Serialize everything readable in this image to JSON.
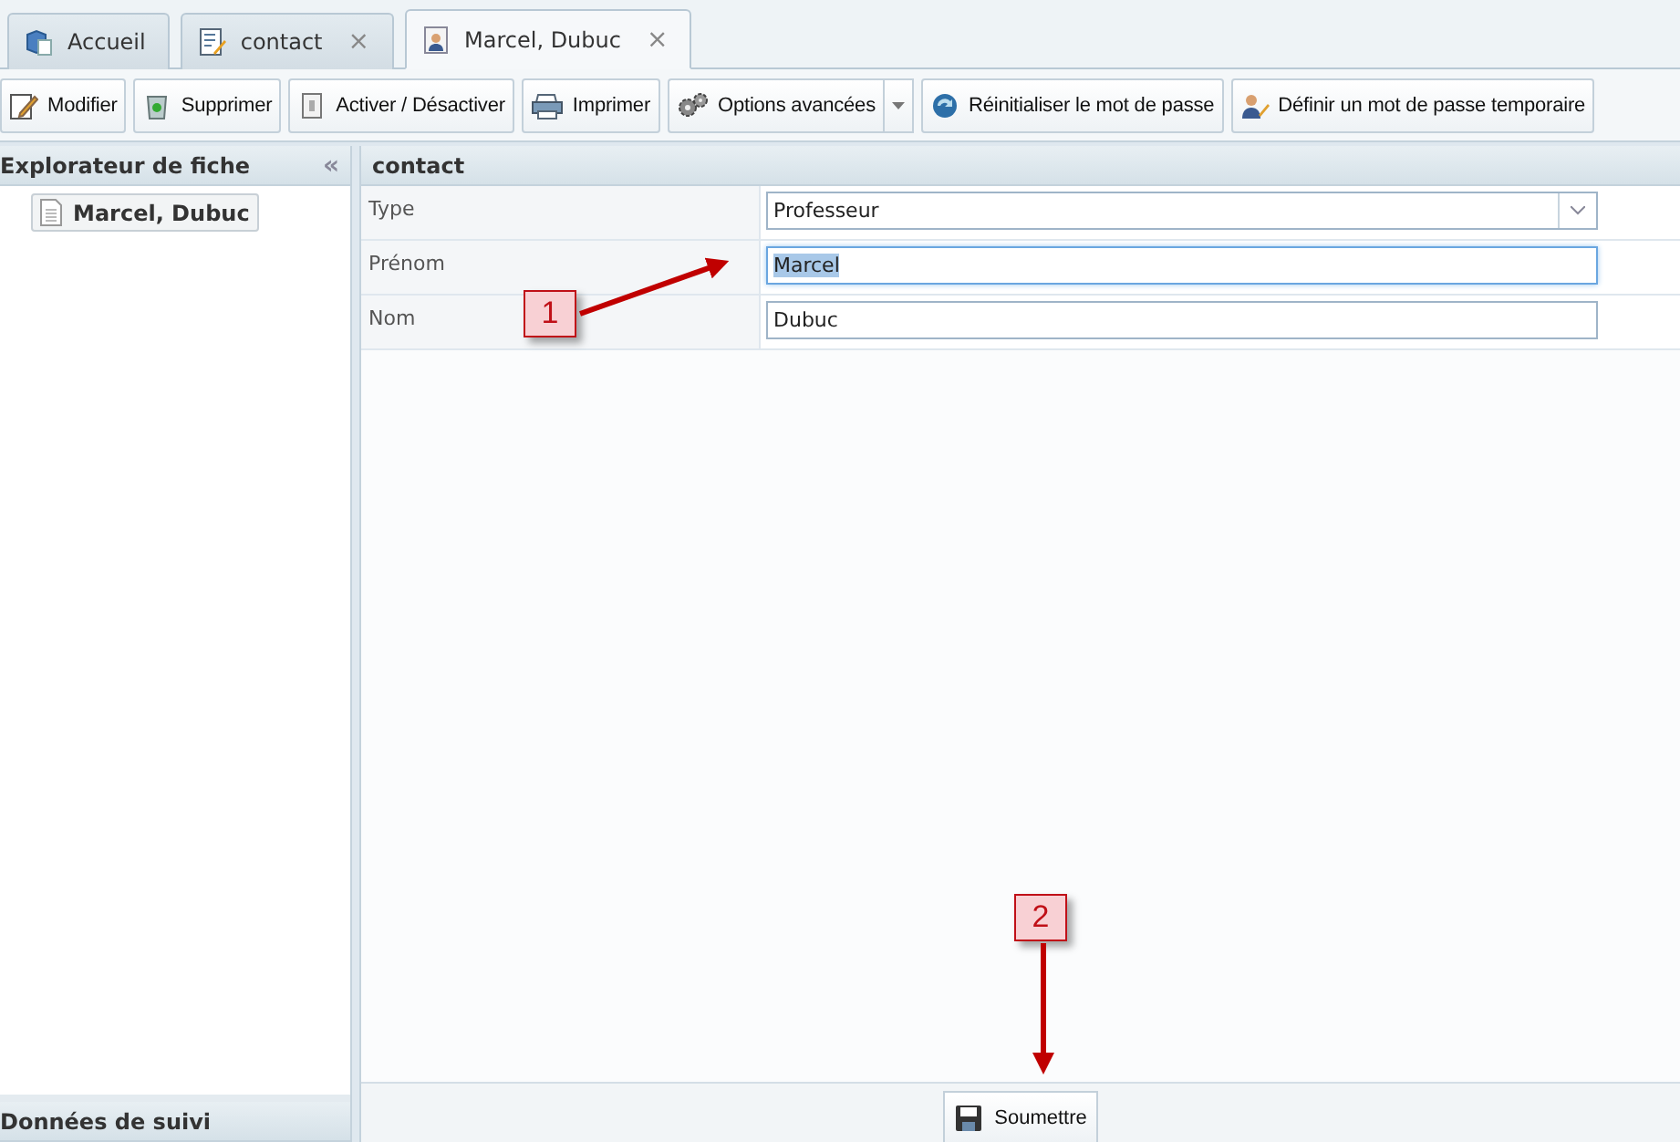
{
  "tabs": [
    {
      "label": "Accueil",
      "selected": false
    },
    {
      "label": "contact",
      "selected": false,
      "close": "×"
    },
    {
      "label": "Marcel, Dubuc",
      "selected": true,
      "close": "×"
    }
  ],
  "toolbar": [
    {
      "label": "Modifier",
      "kind": "button"
    },
    {
      "label": "Supprimer",
      "kind": "button"
    },
    {
      "label": "Activer / Désactiver",
      "kind": "button"
    },
    {
      "label": "Imprimer",
      "kind": "button"
    },
    {
      "label": "Options avancées",
      "kind": "split"
    },
    {
      "label": "Réinitialiser le mot de passe",
      "kind": "button"
    },
    {
      "label": "Définir un mot de passe temporaire",
      "kind": "button"
    }
  ],
  "explorer": {
    "title": "Explorateur de fiche",
    "collapse": "«",
    "items": [
      {
        "label": "Marcel, Dubuc"
      }
    ]
  },
  "tracking": {
    "title": "Données de suivi"
  },
  "form": {
    "title": "contact",
    "fields": [
      {
        "label": "Type",
        "kind": "select",
        "value": "Professeur",
        "focused": false
      },
      {
        "label": "Prénom",
        "kind": "text",
        "value": "Marcel",
        "focused": true
      },
      {
        "label": "Nom",
        "kind": "text",
        "value": "Dubuc",
        "focused": false
      }
    ]
  },
  "submit": "Soumettre",
  "callouts": [
    {
      "label": "1"
    },
    {
      "label": "2"
    }
  ]
}
